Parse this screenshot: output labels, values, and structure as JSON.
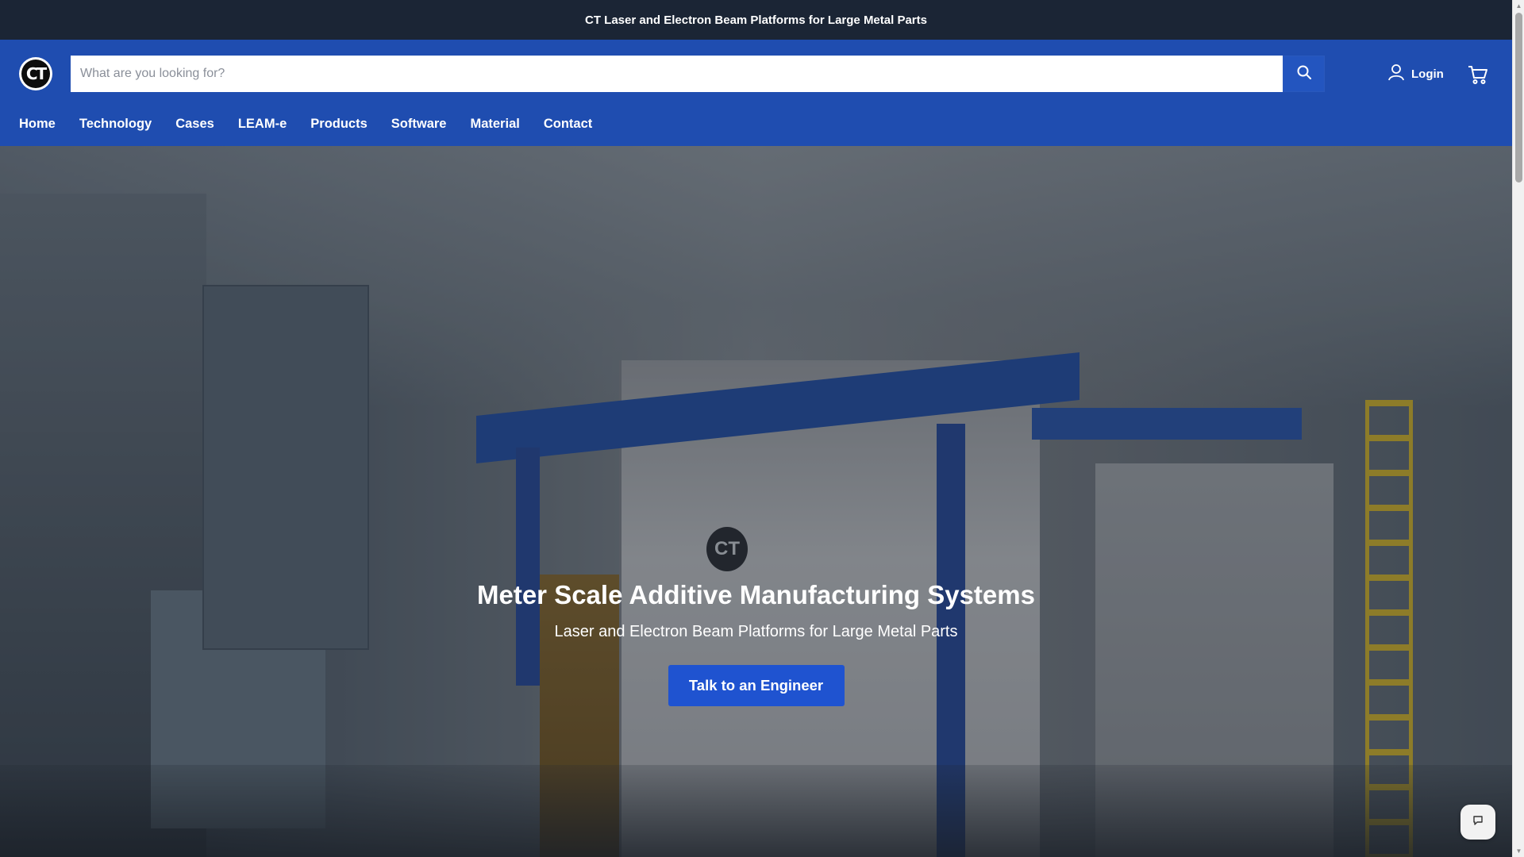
{
  "announcement": {
    "text": "CT Laser and Electron Beam Platforms for Large Metal Parts"
  },
  "header": {
    "logo_text": "CT",
    "search": {
      "placeholder": "What are you looking for?",
      "value": ""
    },
    "login_label": "Login",
    "icons": {
      "search": "search-icon",
      "account": "user-icon",
      "cart": "cart-icon"
    }
  },
  "nav": {
    "items": [
      {
        "label": "Home"
      },
      {
        "label": "Technology"
      },
      {
        "label": "Cases"
      },
      {
        "label": "LEAM-e"
      },
      {
        "label": "Products"
      },
      {
        "label": "Software"
      },
      {
        "label": "Material"
      },
      {
        "label": "Contact"
      }
    ]
  },
  "hero": {
    "title": "Meter Scale Additive Manufacturing Systems",
    "subtitle": "Laser and Electron Beam Platforms for Large Metal Parts",
    "cta_label": "Talk to an Engineer",
    "badge_text": "CT"
  },
  "colors": {
    "announcement_bg": "#1b2535",
    "header_bg": "#1f4db0",
    "cta_bg": "#1f53d0",
    "text_light": "#ffffff"
  }
}
